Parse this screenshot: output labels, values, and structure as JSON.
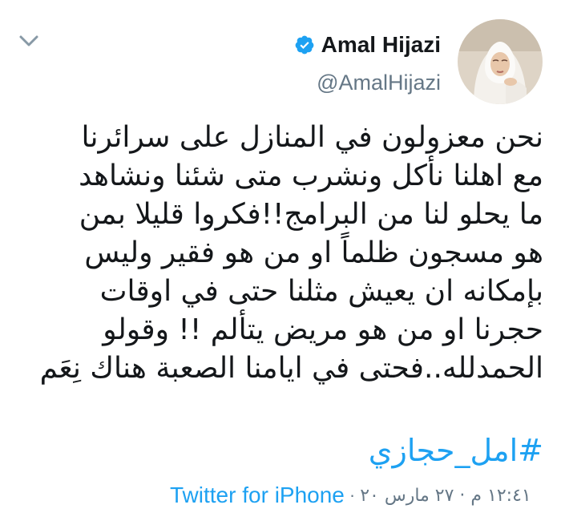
{
  "tweet": {
    "display_name": "Amal Hijazi",
    "handle": "@AmalHijazi",
    "text_lines": [
      "نحن معزولون في المنازل على سرائرنا",
      "مع اهلنا نأكل ونشرب متى شئنا ونشاهد",
      "ما يحلو لنا من البرامج!!فكروا قليلا بمن",
      "هو مسجون ظلماً او من هو فقير وليس",
      "بإمكانه ان يعيش مثلنا حتى في اوقات",
      "حجرنا او من هو مريض يتألم !! وقولو",
      "الحمدلله..فحتى في ايامنا الصعبة هناك نِعَم"
    ],
    "hashtag": "#امل_حجازي",
    "timestamp": "١٢:٤١ م · ٢٧ مارس ٢٠",
    "separator": "·",
    "source": "Twitter for iPhone"
  },
  "icons": {
    "menu": "chevron-down-icon",
    "verified": "verified-badge-icon",
    "avatar": "profile-photo"
  },
  "colors": {
    "link": "#1da1f2",
    "secondary_text": "#657786",
    "primary_text": "#14171a",
    "verified": "#1da1f2"
  }
}
